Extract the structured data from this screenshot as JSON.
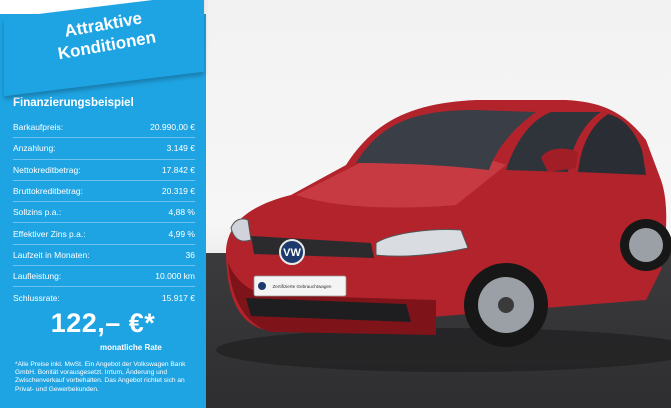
{
  "badge": {
    "line1": "Attraktive",
    "line2": "Konditionen"
  },
  "financing": {
    "title": "Finanzierungsbeispiel",
    "rows": [
      {
        "label": "Barkaufpreis:",
        "value": "20.990,00 €"
      },
      {
        "label": "Anzahlung:",
        "value": "3.149 €"
      },
      {
        "label": "Nettokreditbetrag:",
        "value": "17.842 €"
      },
      {
        "label": "Bruttokreditbetrag:",
        "value": "20.319 €"
      },
      {
        "label": "Sollzins p.a.:",
        "value": "4,88 %"
      },
      {
        "label": "Effektiver Zins p.a.:",
        "value": "4,99 %"
      },
      {
        "label": "Laufzeit in Monaten:",
        "value": "36"
      },
      {
        "label": "Laufleistung:",
        "value": "10.000 km"
      },
      {
        "label": "Schlussrate:",
        "value": "15.917 €"
      }
    ],
    "price": "122,– €*",
    "price_caption": "monatliche Rate",
    "disclaimer": "*Alle Preise inkl. MwSt. Ein Angebot der Volkswagen Bank GmbH. Bonität vorausgesetzt. Irrtum, Änderung und Zwischenverkauf vorbehalten. Das Angebot richtet sich an Privat- und Gewerbekunden."
  },
  "car": {
    "plate_text": "Zertifizierte Gebrauchtwagen",
    "logo": "vw-logo-icon",
    "color": "#b3232c"
  },
  "colors": {
    "panel": "#1fa4e3",
    "text": "#ffffff"
  }
}
